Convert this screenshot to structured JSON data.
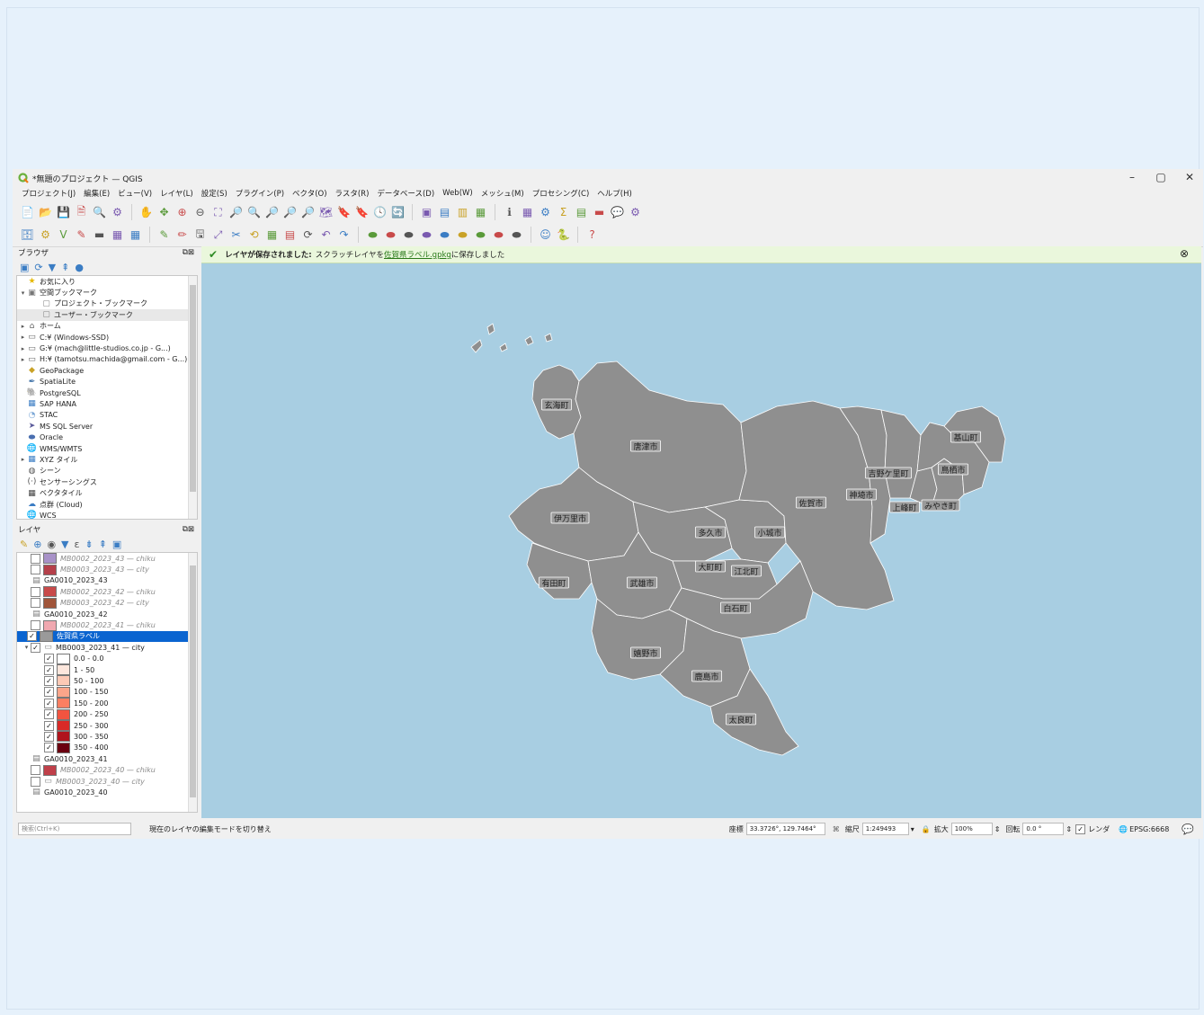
{
  "window": {
    "title": "*無題のプロジェクト — QGIS",
    "controls": [
      "–",
      "▢",
      "✕"
    ]
  },
  "menubar": [
    "プロジェクト(J)",
    "編集(E)",
    "ビュー(V)",
    "レイヤ(L)",
    "設定(S)",
    "プラグイン(P)",
    "ベクタ(O)",
    "ラスタ(R)",
    "データベース(D)",
    "Web(W)",
    "メッシュ(M)",
    "プロセシング(C)",
    "ヘルプ(H)"
  ],
  "toolbar1": [
    "📄",
    "📂",
    "💾",
    "🗎",
    "🔍",
    "⚙",
    "|",
    "✋",
    "✥",
    "⊕",
    "⊖",
    "⛶",
    "🔎",
    "🔍",
    "🔎",
    "🔎",
    "🔎",
    "🗺",
    "🔖",
    "🔖",
    "🕓",
    "🔄",
    "|",
    "▣",
    "▤",
    "▥",
    "▦",
    "|",
    "ℹ",
    "▦",
    "⚙",
    "Σ",
    "▤",
    "▬",
    "💬",
    "⚙"
  ],
  "toolbar2": [
    "🗄",
    "⚙",
    "V",
    "✎",
    "▬",
    "▦",
    "▦",
    "|",
    "✎",
    "✏",
    "🖫",
    "⤢",
    "✂",
    "⟲",
    "▦",
    "▤",
    "⟳",
    "↶",
    "↷",
    "|",
    "⬬",
    "⬬",
    "⬬",
    "⬬",
    "⬬",
    "⬬",
    "⬬",
    "⬬",
    "⬬",
    "|",
    "☺",
    "🐍",
    "|",
    "?"
  ],
  "browser": {
    "title": "ブラウザ",
    "items": [
      {
        "label": "お気に入り",
        "icon": "★",
        "icon_color": "#e6b800",
        "indent": 0,
        "expander": ""
      },
      {
        "label": "空間ブックマーク",
        "icon": "▣",
        "icon_color": "#777777",
        "indent": 0,
        "expander": "▾"
      },
      {
        "label": "プロジェクト・ブックマーク",
        "icon": "▢",
        "icon_color": "#888888",
        "indent": 1,
        "expander": ""
      },
      {
        "label": "ユーザー・ブックマーク",
        "icon": "▢",
        "icon_color": "#888888",
        "indent": 1,
        "expander": ""
      },
      {
        "label": "ホーム",
        "icon": "⌂",
        "icon_color": "#666666",
        "indent": 0,
        "expander": "▸"
      },
      {
        "label": "C:¥ (Windows-SSD)",
        "icon": "▭",
        "icon_color": "#666666",
        "indent": 0,
        "expander": "▸"
      },
      {
        "label": "G:¥ (mach@little-studios.co.jp - G...)",
        "icon": "▭",
        "icon_color": "#666666",
        "indent": 0,
        "expander": "▸"
      },
      {
        "label": "H:¥ (tamotsu.machida@gmail.com - G...)",
        "icon": "▭",
        "icon_color": "#666666",
        "indent": 0,
        "expander": "▸"
      },
      {
        "label": "GeoPackage",
        "icon": "◆",
        "icon_color": "#c9a227",
        "indent": 0,
        "expander": ""
      },
      {
        "label": "SpatiaLite",
        "icon": "✒",
        "icon_color": "#3a6ea5",
        "indent": 0,
        "expander": ""
      },
      {
        "label": "PostgreSQL",
        "icon": "🐘",
        "icon_color": "#336791",
        "indent": 0,
        "expander": ""
      },
      {
        "label": "SAP HANA",
        "icon": "▦",
        "icon_color": "#3b7dc4",
        "indent": 0,
        "expander": ""
      },
      {
        "label": "STAC",
        "icon": "◔",
        "icon_color": "#7aa6d6",
        "indent": 0,
        "expander": ""
      },
      {
        "label": "MS SQL Server",
        "icon": "➤",
        "icon_color": "#5a5a9a",
        "indent": 0,
        "expander": ""
      },
      {
        "label": "Oracle",
        "icon": "⬬",
        "icon_color": "#4a6fb0",
        "indent": 0,
        "expander": ""
      },
      {
        "label": "WMS/WMTS",
        "icon": "🌐",
        "icon_color": "#3b7dc4",
        "indent": 0,
        "expander": ""
      },
      {
        "label": "XYZ タイル",
        "icon": "▦",
        "icon_color": "#3b7dc4",
        "indent": 0,
        "expander": "▸"
      },
      {
        "label": "シーン",
        "icon": "◍",
        "icon_color": "#555555",
        "indent": 0,
        "expander": ""
      },
      {
        "label": "センサーシングス",
        "icon": "(·)",
        "icon_color": "#555555",
        "indent": 0,
        "expander": ""
      },
      {
        "label": "ベクタタイル",
        "icon": "▦",
        "icon_color": "#444444",
        "indent": 0,
        "expander": ""
      },
      {
        "label": "点群 (Cloud)",
        "icon": "☁",
        "icon_color": "#3b7dc4",
        "indent": 0,
        "expander": ""
      },
      {
        "label": "WCS",
        "icon": "🌐",
        "icon_color": "#3b7dc4",
        "indent": 0,
        "expander": ""
      }
    ]
  },
  "layers": {
    "title": "レイヤ",
    "items": [
      {
        "kind": "layer",
        "label": "MB0002_2023_43 — chiku",
        "color": "#a892c8",
        "checked": false,
        "dim": true,
        "indent": 1
      },
      {
        "kind": "layer",
        "label": "MB0003_2023_43 — city",
        "color": "#b5404a",
        "checked": false,
        "dim": true,
        "indent": 1
      },
      {
        "kind": "group",
        "label": "GA0010_2023_43",
        "indent": 0
      },
      {
        "kind": "layer",
        "label": "MB0002_2023_42 — chiku",
        "color": "#c84a4a",
        "checked": false,
        "dim": true,
        "indent": 1
      },
      {
        "kind": "layer",
        "label": "MB0003_2023_42 — city",
        "color": "#a0553a",
        "checked": false,
        "dim": true,
        "indent": 1
      },
      {
        "kind": "group",
        "label": "GA0010_2023_42",
        "indent": 0
      },
      {
        "kind": "layer",
        "label": "MB0002_2023_41 — chiku",
        "color": "#f0a8b0",
        "checked": false,
        "dim": true,
        "indent": 1
      },
      {
        "kind": "selected",
        "label": "佐賀県ラベル",
        "color": "#9a9a9a",
        "checked": true,
        "indent": 0
      },
      {
        "kind": "graduated",
        "label": "MB0003_2023_41 — city",
        "checked": true,
        "indent": 0
      },
      {
        "kind": "class",
        "label": "0.0 - 0.0",
        "color": "#ffffff",
        "checked": true
      },
      {
        "kind": "class",
        "label": "1 - 50",
        "color": "#fde7dd",
        "checked": true
      },
      {
        "kind": "class",
        "label": "50 - 100",
        "color": "#fcc9b5",
        "checked": true
      },
      {
        "kind": "class",
        "label": "100 - 150",
        "color": "#fca58a",
        "checked": true
      },
      {
        "kind": "class",
        "label": "150 - 200",
        "color": "#fb7f62",
        "checked": true
      },
      {
        "kind": "class",
        "label": "200 - 250",
        "color": "#f25440",
        "checked": true
      },
      {
        "kind": "class",
        "label": "250 - 300",
        "color": "#d92a27",
        "checked": true
      },
      {
        "kind": "class",
        "label": "300 - 350",
        "color": "#b0141c",
        "checked": true
      },
      {
        "kind": "class",
        "label": "350 - 400",
        "color": "#6b0010",
        "checked": true
      },
      {
        "kind": "group",
        "label": "GA0010_2023_41",
        "indent": 0
      },
      {
        "kind": "layer",
        "label": "MB0002_2023_40 — chiku",
        "color": "#c0404a",
        "checked": false,
        "dim": true,
        "indent": 1
      },
      {
        "kind": "layer_outline",
        "label": "MB0003_2023_40 — city",
        "checked": false,
        "dim": true,
        "indent": 1
      },
      {
        "kind": "group",
        "label": "GA0010_2023_40",
        "indent": 0
      }
    ]
  },
  "message": {
    "bold": "レイヤが保存されました:",
    "pre": "スクラッチレイヤを",
    "link": "佐賀県ラベル.gpkg",
    "post": "に保存しました"
  },
  "map": {
    "background": "#a8cee2",
    "land": "#8f8f8f",
    "labels": [
      "玄海町",
      "唐津市",
      "伊万里市",
      "有田町",
      "多久市",
      "小城市",
      "佐賀市",
      "神埼市",
      "吉野ケ里町",
      "上峰町",
      "みやき町",
      "鳥栖市",
      "基山町",
      "大町町",
      "江北町",
      "武雄市",
      "白石町",
      "嬉野市",
      "鹿島市",
      "太良町"
    ]
  },
  "status": {
    "search_placeholder": "検索(Ctrl+K)",
    "hint": "現在のレイヤの編集モードを切り替え",
    "coord_label": "座標",
    "coord": "33.3726°, 129.7464°",
    "scale_label": "縮尺",
    "scale": "1:249493",
    "mag_label": "拡大",
    "mag": "100%",
    "rot_label": "回転",
    "rot": "0.0 °",
    "render_label": "レンダ",
    "crs": "EPSG:6668"
  }
}
